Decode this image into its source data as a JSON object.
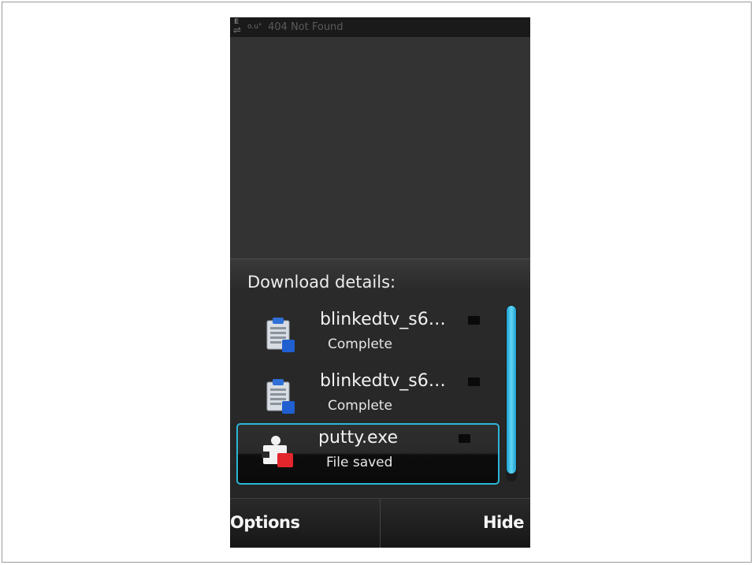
{
  "status_bar": {
    "signal_mode": "E",
    "battery_text": "o.u°",
    "page_title": "404 Not Found"
  },
  "dialog": {
    "title": "Download details:",
    "downloads": [
      {
        "name": "blinkedtv_s6…",
        "status": "Complete",
        "icon": "document-icon",
        "storage_icon": "memory-card-icon"
      },
      {
        "name": "blinkedtv_s6…",
        "status": "Complete",
        "icon": "document-icon",
        "storage_icon": "memory-card-icon"
      },
      {
        "name": "putty.exe",
        "status": "File saved",
        "icon": "application-package-icon",
        "storage_icon": "memory-card-icon",
        "selected": true
      }
    ]
  },
  "softkeys": {
    "left": "Options",
    "right": "Hide"
  },
  "colors": {
    "accent": "#2bb6d6",
    "scrollbar": "#3fc8ef",
    "background": "#333333"
  }
}
